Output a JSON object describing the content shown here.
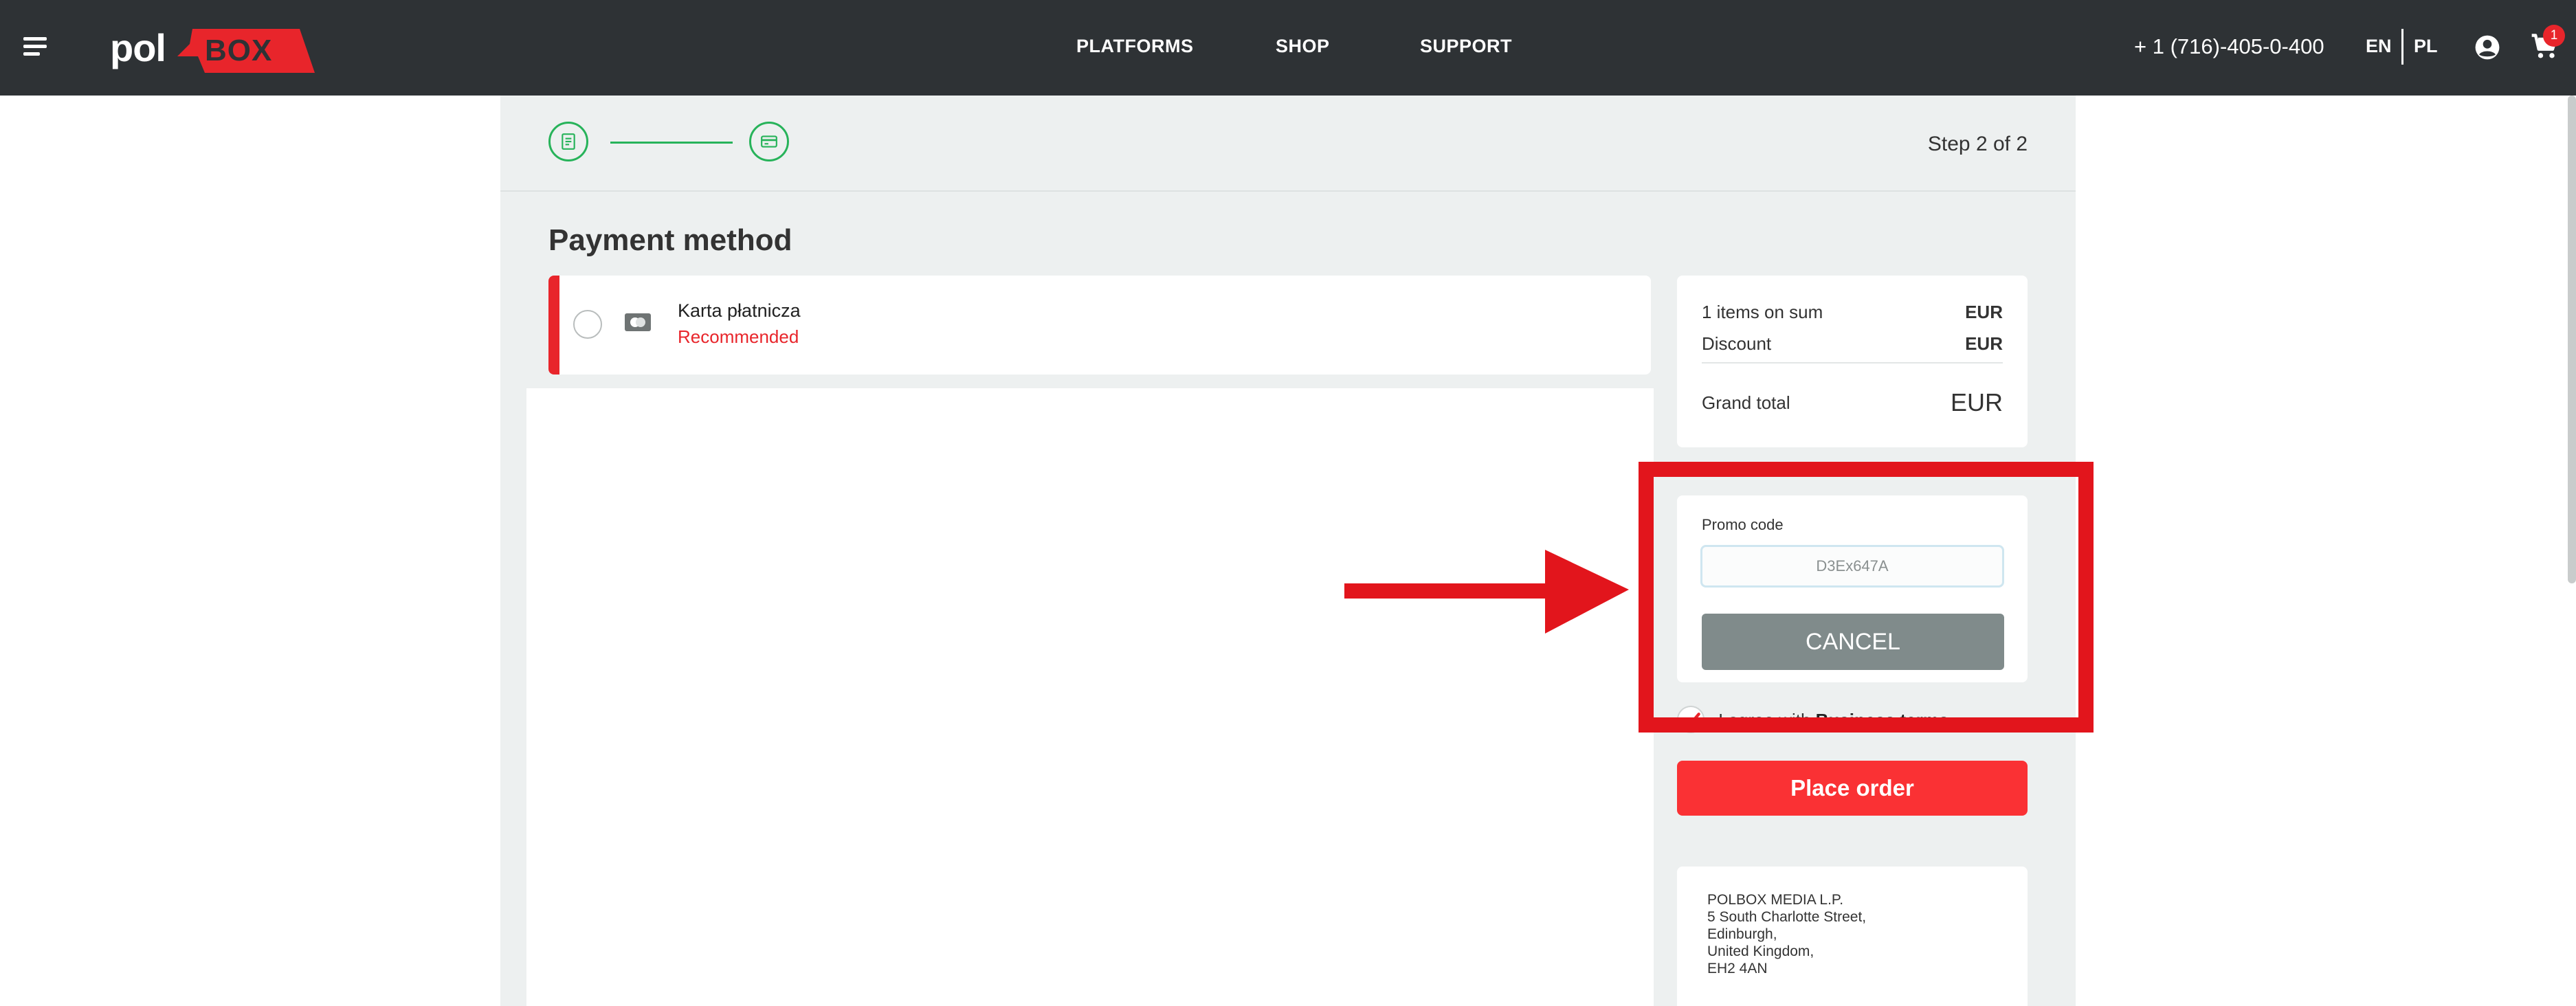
{
  "nav": {
    "logo_pol": "pol",
    "logo_box": "BOX",
    "links": [
      "PLATFORMS",
      "SHOP",
      "SUPPORT"
    ],
    "phone": "+ 1 (716)-405-0-400",
    "lang_en": "EN",
    "lang_pl": "PL",
    "cart_count": "1",
    "icons": [
      "hamburger-icon",
      "user-icon",
      "cart-icon"
    ]
  },
  "steps": {
    "text": "Step 2 of 2",
    "icons": [
      "receipt-icon",
      "credit-card-icon"
    ],
    "color": "#27b35a"
  },
  "page": {
    "title": "Payment method"
  },
  "payment_methods": [
    {
      "name": "Karta płatnicza",
      "tag": "Recommended",
      "selected": false
    }
  ],
  "summary": {
    "items_label": "1 items on sum",
    "items_value": "EUR",
    "discount_label": "Discount",
    "discount_value": "EUR",
    "grand_label": "Grand total",
    "grand_value": "EUR"
  },
  "promo": {
    "label": "Promo code",
    "value": "D3Ex647A",
    "button": "CANCEL"
  },
  "terms": {
    "prefix": "I agree with ",
    "link": "Business terms",
    "checked": true
  },
  "order": {
    "button": "Place order"
  },
  "company": {
    "lines": [
      "POLBOX MEDIA L.P.",
      "5 South Charlotte Street,",
      "Edinburgh,",
      "United Kingdom,",
      "EH2 4AN"
    ]
  },
  "colors": {
    "accent_red": "#e8252b",
    "nav_bg": "#2e3235",
    "button_red": "#fa3134",
    "button_grey": "#808b8b"
  }
}
